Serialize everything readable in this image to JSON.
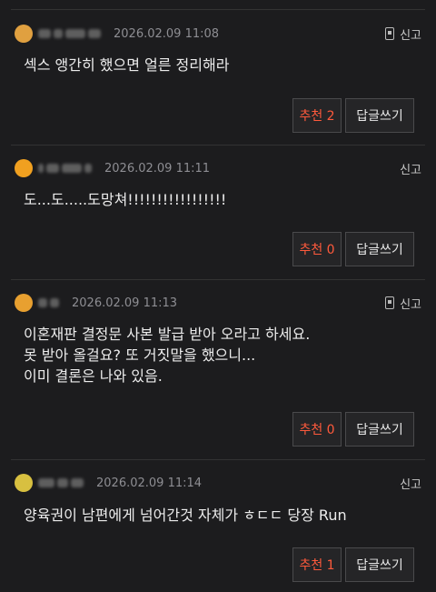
{
  "comments": [
    {
      "date": "2026.02.09 11:08",
      "report_label": "신고",
      "text_lines": [
        "섹스 앵간히 했으면 얼른 정리해라"
      ],
      "recommend_label": "추천 2",
      "reply_label": "답글쓰기",
      "avatar_color": "#e0a040",
      "show_device_icon": true
    },
    {
      "date": "2026.02.09 11:11",
      "report_label": "신고",
      "text_lines": [
        "도...도.....도망쳐!!!!!!!!!!!!!!!!!"
      ],
      "recommend_label": "추천 0",
      "reply_label": "답글쓰기",
      "avatar_color": "#f0a020",
      "show_device_icon": false
    },
    {
      "date": "2026.02.09 11:13",
      "report_label": "신고",
      "text_lines": [
        "이혼재판 결정문 사본 발급 받아 오라고 하세요.",
        "못 받아 올걸요? 또 거짓말을 했으니...",
        "이미 결론은 나와 있음."
      ],
      "recommend_label": "추천 0",
      "reply_label": "답글쓰기",
      "avatar_color": "#e8a030",
      "show_device_icon": true
    },
    {
      "date": "2026.02.09 11:14",
      "report_label": "신고",
      "text_lines": [
        "양육권이 남편에게 넘어간것 자체가 ㅎㄷㄷ 당장 Run"
      ],
      "recommend_label": "추천 1",
      "reply_label": "답글쓰기",
      "avatar_color": "#d8c040",
      "show_device_icon": false
    }
  ],
  "colors": {
    "background": "#1c1c1e",
    "recommend_text": "#ff5a3c",
    "divider": "#333333",
    "date_text": "#8e8e93"
  }
}
